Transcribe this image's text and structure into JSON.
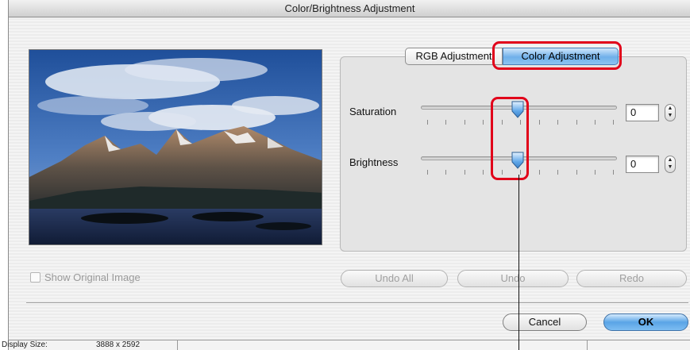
{
  "window": {
    "title": "Color/Brightness Adjustment"
  },
  "tabs": [
    {
      "label": "RGB Adjustment",
      "active": false
    },
    {
      "label": "Color Adjustment",
      "active": true
    }
  ],
  "sliders": [
    {
      "label": "Saturation",
      "value": "0",
      "position": 0.5
    },
    {
      "label": "Brightness",
      "value": "0",
      "position": 0.5
    }
  ],
  "show_original": {
    "label": "Show Original Image",
    "checked": false,
    "enabled": false
  },
  "buttons": {
    "undo_all": "Undo All",
    "undo": "Undo",
    "redo": "Redo",
    "cancel": "Cancel",
    "ok": "OK"
  },
  "status": {
    "display_size_label": "Display Size:",
    "display_size_value": "3888 x 2592"
  },
  "colors": {
    "accent_blue": "#6fb0ea",
    "annotation_red": "#e1001a"
  },
  "icons": {
    "stepper": "up-down-stepper-icon",
    "thumb": "slider-thumb-icon"
  }
}
